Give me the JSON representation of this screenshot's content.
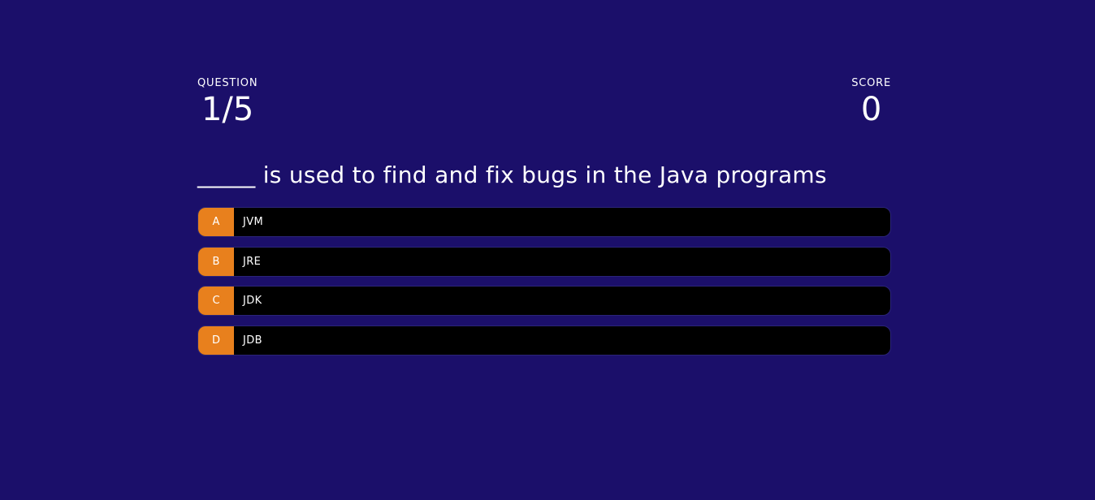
{
  "hud": {
    "question_label": "QUESTION",
    "question_progress": "1/5",
    "score_label": "SCORE",
    "score_value": "0"
  },
  "question": {
    "text": "_____ is used to find and fix bugs in the Java programs"
  },
  "options": [
    {
      "letter": "A",
      "text": "JVM"
    },
    {
      "letter": "B",
      "text": "JRE"
    },
    {
      "letter": "C",
      "text": "JDK"
    },
    {
      "letter": "D",
      "text": "JDB"
    }
  ],
  "colors": {
    "background": "#1b0f6a",
    "option_badge": "#e8801d",
    "option_body": "#000000",
    "text": "#ffffff"
  }
}
